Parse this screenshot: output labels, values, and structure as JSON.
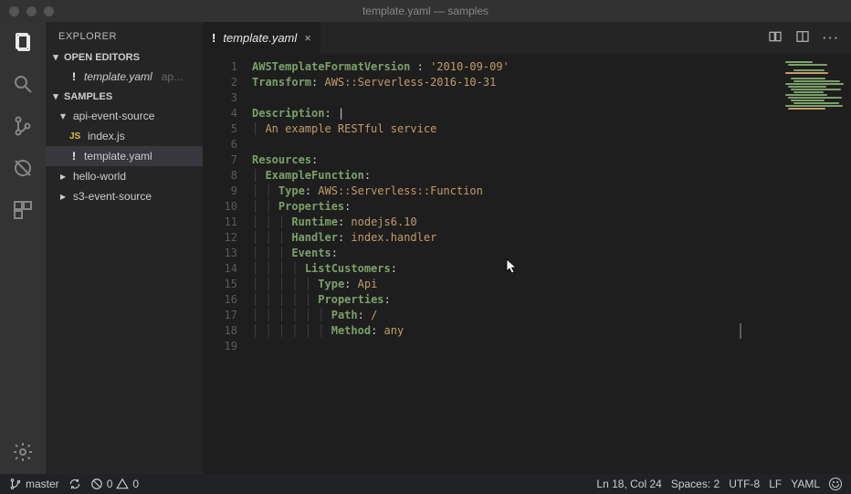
{
  "titlebar": {
    "title": "template.yaml — samples"
  },
  "sidebar": {
    "title": "EXPLORER",
    "openEditors": {
      "label": "OPEN EDITORS",
      "items": [
        {
          "modified": "!",
          "name": "template.yaml",
          "hint": "ap..."
        }
      ]
    },
    "folder": {
      "label": "SAMPLES",
      "tree": [
        {
          "kind": "folder",
          "expanded": true,
          "name": "api-event-source"
        },
        {
          "kind": "file",
          "icon": "JS",
          "name": "index.js"
        },
        {
          "kind": "file",
          "modified": "!",
          "name": "template.yaml",
          "selected": true
        },
        {
          "kind": "folder",
          "expanded": false,
          "name": "hello-world"
        },
        {
          "kind": "folder",
          "expanded": false,
          "name": "s3-event-source"
        }
      ]
    }
  },
  "tab": {
    "modified": "!",
    "name": "template.yaml",
    "close": "×"
  },
  "code": {
    "lines": [
      {
        "n": 1,
        "tokens": [
          [
            "key",
            "AWSTemplateFormatVersion "
          ],
          [
            "plain",
            ": "
          ],
          [
            "str",
            "'2010-09-09'"
          ]
        ]
      },
      {
        "n": 2,
        "tokens": [
          [
            "key",
            "Transform"
          ],
          [
            "plain",
            ": "
          ],
          [
            "str",
            "AWS::Serverless-2016-10-31"
          ]
        ]
      },
      {
        "n": 3,
        "tokens": []
      },
      {
        "n": 4,
        "tokens": [
          [
            "key",
            "Description"
          ],
          [
            "plain",
            ": "
          ],
          [
            "plain",
            "|"
          ]
        ]
      },
      {
        "n": 5,
        "indent": 1,
        "tokens": [
          [
            "comment",
            "An example RESTful service"
          ]
        ]
      },
      {
        "n": 6,
        "tokens": []
      },
      {
        "n": 7,
        "tokens": [
          [
            "key",
            "Resources"
          ],
          [
            "plain",
            ":"
          ]
        ]
      },
      {
        "n": 8,
        "indent": 1,
        "tokens": [
          [
            "key",
            "ExampleFunction"
          ],
          [
            "plain",
            ":"
          ]
        ]
      },
      {
        "n": 9,
        "indent": 2,
        "tokens": [
          [
            "key",
            "Type"
          ],
          [
            "plain",
            ": "
          ],
          [
            "str",
            "AWS::Serverless::Function"
          ]
        ]
      },
      {
        "n": 10,
        "indent": 2,
        "tokens": [
          [
            "key",
            "Properties"
          ],
          [
            "plain",
            ":"
          ]
        ]
      },
      {
        "n": 11,
        "indent": 3,
        "tokens": [
          [
            "key",
            "Runtime"
          ],
          [
            "plain",
            ": "
          ],
          [
            "str",
            "nodejs6.10"
          ]
        ]
      },
      {
        "n": 12,
        "indent": 3,
        "tokens": [
          [
            "key",
            "Handler"
          ],
          [
            "plain",
            ": "
          ],
          [
            "str",
            "index.handler"
          ]
        ]
      },
      {
        "n": 13,
        "indent": 3,
        "tokens": [
          [
            "key",
            "Events"
          ],
          [
            "plain",
            ":"
          ]
        ]
      },
      {
        "n": 14,
        "indent": 4,
        "tokens": [
          [
            "key",
            "ListCustomers"
          ],
          [
            "plain",
            ":"
          ]
        ]
      },
      {
        "n": 15,
        "indent": 5,
        "tokens": [
          [
            "key",
            "Type"
          ],
          [
            "plain",
            ": "
          ],
          [
            "str",
            "Api"
          ]
        ]
      },
      {
        "n": 16,
        "indent": 5,
        "tokens": [
          [
            "key",
            "Properties"
          ],
          [
            "plain",
            ":"
          ]
        ]
      },
      {
        "n": 17,
        "indent": 6,
        "tokens": [
          [
            "key",
            "Path"
          ],
          [
            "plain",
            ": "
          ],
          [
            "str",
            "/"
          ]
        ]
      },
      {
        "n": 18,
        "indent": 6,
        "hl": true,
        "tokens": [
          [
            "key",
            "Method"
          ],
          [
            "plain",
            ": "
          ],
          [
            "str",
            "any"
          ]
        ]
      },
      {
        "n": 19,
        "tokens": []
      }
    ]
  },
  "statusbar": {
    "branch": "master",
    "errors": "0",
    "warnings": "0",
    "lncol": "Ln 18, Col 24",
    "spaces": "Spaces: 2",
    "encoding": "UTF-8",
    "eol": "LF",
    "lang": "YAML"
  }
}
